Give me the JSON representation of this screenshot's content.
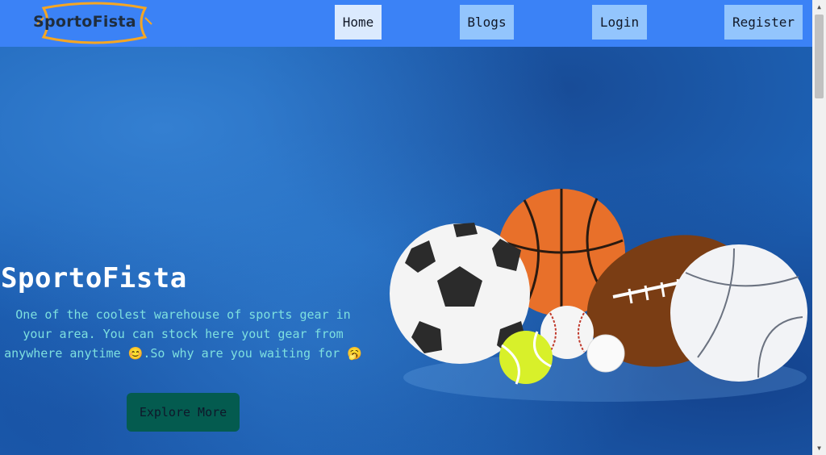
{
  "brand": {
    "logo_text": "SportoFista"
  },
  "nav": {
    "home": "Home",
    "blogs": "Blogs",
    "login": "Login",
    "register": "Register"
  },
  "hero": {
    "title": "SportoFista",
    "description_part1": "One of the coolest warehouse of sports gear in your area. You can stock here yout gear from anywhere anytime ",
    "emoji1": "😊",
    "description_part2": ".So why are you waiting for ",
    "emoji2": "🥱",
    "cta": "Explore More"
  },
  "colors": {
    "navbar": "#3b82f6",
    "nav_active": "#dbeafe",
    "nav_button": "#93c5fd",
    "hero_text": "#7ee0df",
    "cta_bg": "#045b4f"
  },
  "icons": [
    "soccer-ball",
    "basketball",
    "american-football",
    "volleyball",
    "baseball",
    "tennis-ball",
    "golf-ball"
  ]
}
